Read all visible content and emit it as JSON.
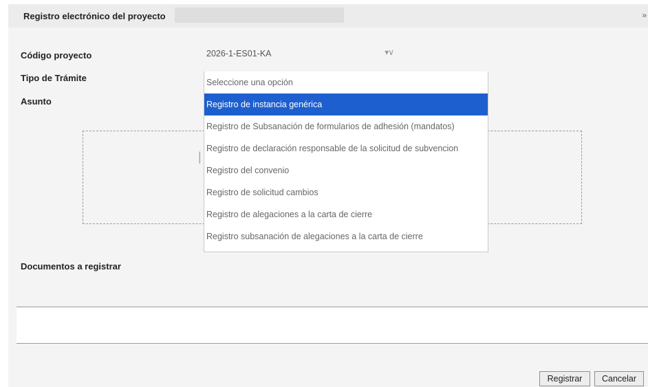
{
  "dialog": {
    "title": "Registro electrónico del proyecto",
    "close_icon": "double-chevron-right-icon"
  },
  "form": {
    "codigo_label": "Código proyecto",
    "codigo_value": "2026-1-ES01-KA",
    "tipo_label": "Tipo de Trámite",
    "asunto_label": "Asunto",
    "documentos_label": "Documentos a registrar"
  },
  "dropdown": {
    "options": [
      "Seleccione una opción",
      "Registro de instancia genérica",
      "Registro de Subsanación de formularios de adhesión (mandatos)",
      "Registro de declaración responsable de la solicitud de subvencion",
      "Registro del convenio",
      "Registro de solicitud cambios",
      "Registro de alegaciones a la carta de cierre",
      "Registro subsanación de alegaciones a la carta de cierre"
    ],
    "selected_index": 1
  },
  "buttons": {
    "registrar": "Registrar",
    "cancelar": "Cancelar"
  }
}
